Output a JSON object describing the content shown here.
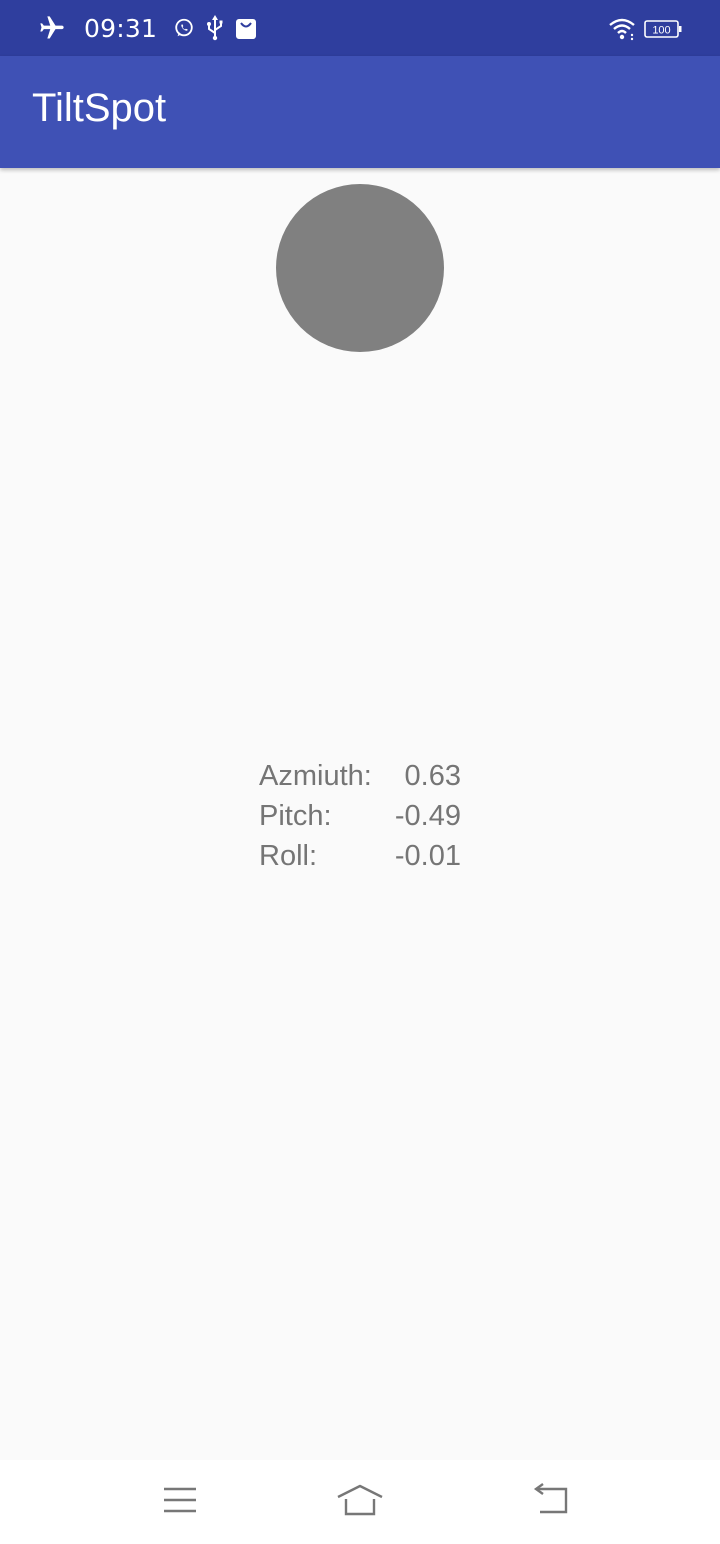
{
  "status_bar": {
    "time": "09:31",
    "left_icons": [
      "airplane-mode-icon",
      "whatsapp-icon",
      "usb-icon",
      "shopping-bag-icon"
    ],
    "right_icons": [
      "wifi-icon",
      "battery-icon"
    ],
    "battery_level": "100",
    "background_color": "#2f3e9e"
  },
  "app_bar": {
    "title": "TiltSpot",
    "background_color": "#3f51b5"
  },
  "spot": {
    "color": "#808080"
  },
  "readings": {
    "azimuth": {
      "label": "Azmiuth:",
      "value": "0.63"
    },
    "pitch": {
      "label": "Pitch:",
      "value": "-0.49"
    },
    "roll": {
      "label": "Roll:",
      "value": "-0.01"
    }
  },
  "nav_bar": {
    "buttons": [
      "menu-icon",
      "home-icon",
      "back-icon"
    ]
  }
}
